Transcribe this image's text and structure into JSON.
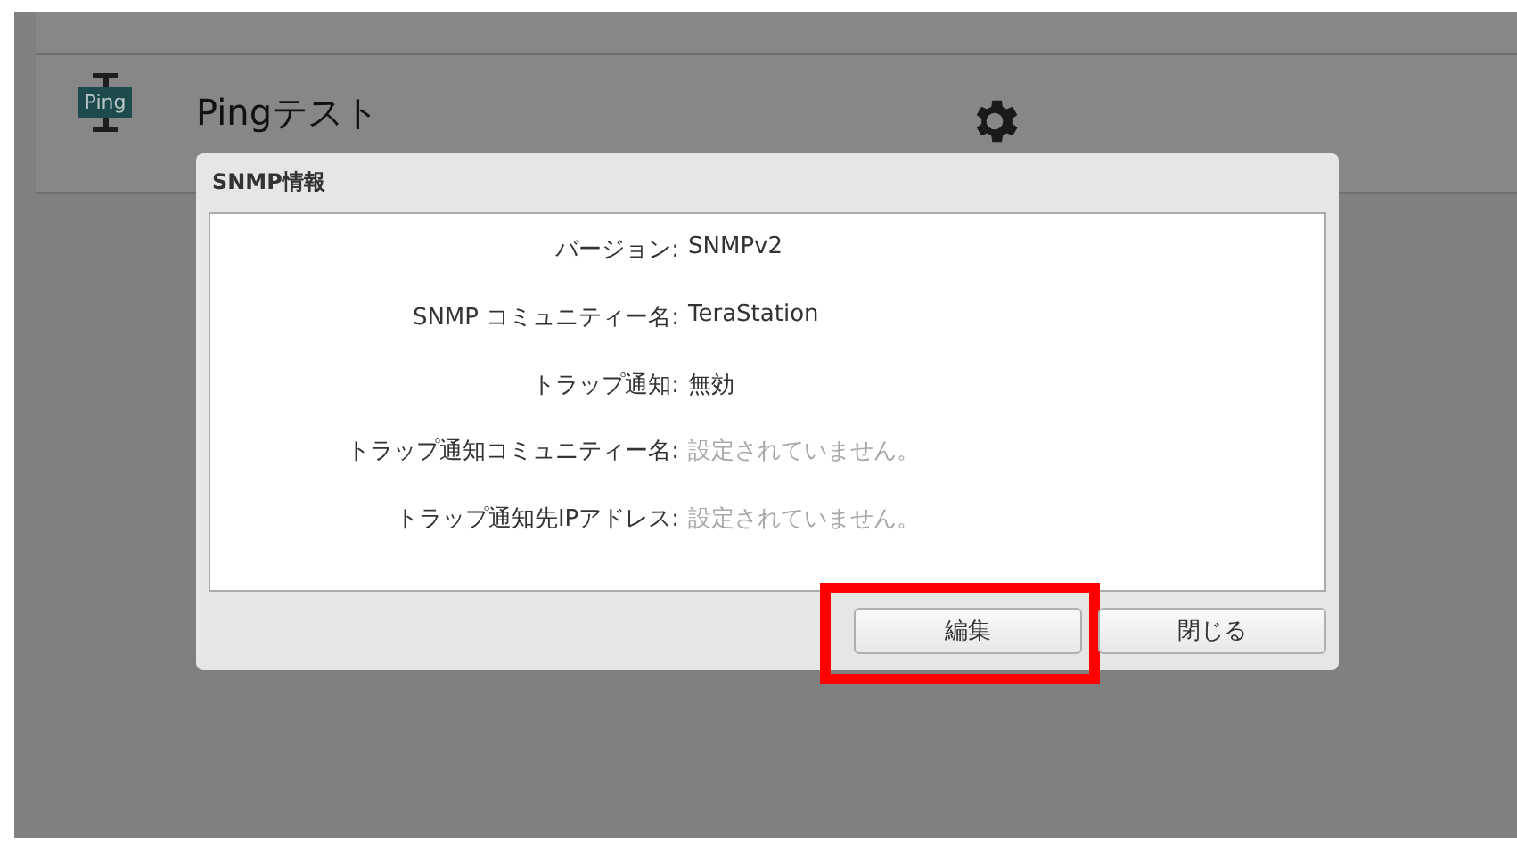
{
  "app_row": {
    "icon_label": "Ping",
    "title": "Pingテスト"
  },
  "dialog": {
    "title": "SNMP情報",
    "fields": [
      {
        "label": "バージョン:",
        "value": "SNMPv2",
        "unset": false
      },
      {
        "label": "SNMP コミュニティー名:",
        "value": "TeraStation",
        "unset": false
      },
      {
        "label": "トラップ通知:",
        "value": "無効",
        "unset": false
      },
      {
        "label": "トラップ通知コミュニティー名:",
        "value": "設定されていません。",
        "unset": true
      },
      {
        "label": "トラップ通知先IPアドレス:",
        "value": "設定されていません。",
        "unset": true
      }
    ],
    "buttons": [
      {
        "label": "編集",
        "highlighted": true
      },
      {
        "label": "閉じる",
        "highlighted": false
      }
    ]
  }
}
